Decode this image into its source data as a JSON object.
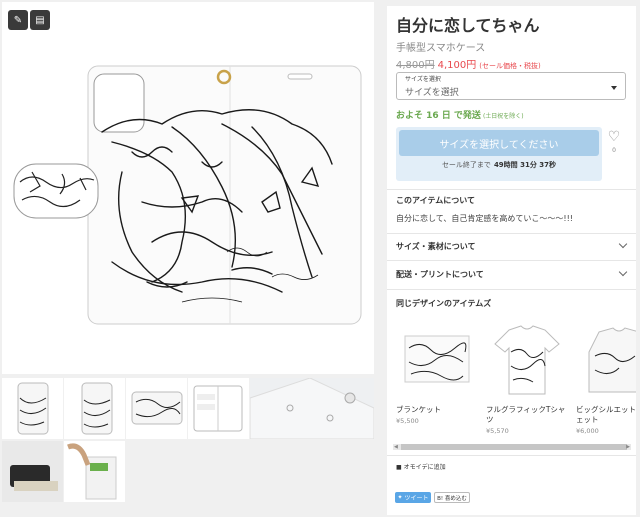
{
  "product": {
    "title": "自分に恋してちゃん",
    "subtitle": "手帳型スマホケース",
    "price_old": "4,800円",
    "price_new": "4,100円",
    "price_note": "(セール価格・税抜)"
  },
  "size_select": {
    "label": "サイズを選択",
    "value": "サイズを選択"
  },
  "shipping": {
    "text": "およそ 16 日 で発送",
    "note": "(土日祝を除く)"
  },
  "cart": {
    "button": "サイズを選択してください",
    "sale_label": "セール終了まで",
    "countdown": "49時間 31分 37秒"
  },
  "favorite": {
    "count": "0"
  },
  "sections": {
    "about_title": "このアイテムについて",
    "about_text": "自分に恋して、自己肯定感を高めていこ〜〜〜!!!",
    "size_material": "サイズ・素材について",
    "shipping_print": "配送・プリントについて",
    "related_title": "同じデザインのアイテムズ"
  },
  "related": [
    {
      "name": "ブランケット",
      "price": "¥5,500"
    },
    {
      "name": "フルグラフィックTシャツ",
      "price": "¥5,570"
    },
    {
      "name": "ビッグシルエットスウェット",
      "price": "¥6,000"
    }
  ],
  "actions": {
    "add_favorite": "オモイデに追加",
    "tweet": "ツイート",
    "hatena": "B! 喜め込む"
  },
  "icons": {
    "edit": "pencil-icon",
    "file": "document-icon",
    "favorite": "heart-icon",
    "folder": "folder-icon",
    "twitter": "twitter-icon"
  },
  "colors": {
    "price_red": "#e8484d",
    "ship_green": "#6aa84f",
    "cart_button": "#a9cde9",
    "cart_bg": "#e2eef8",
    "tweet_blue": "#5aa6e6"
  }
}
